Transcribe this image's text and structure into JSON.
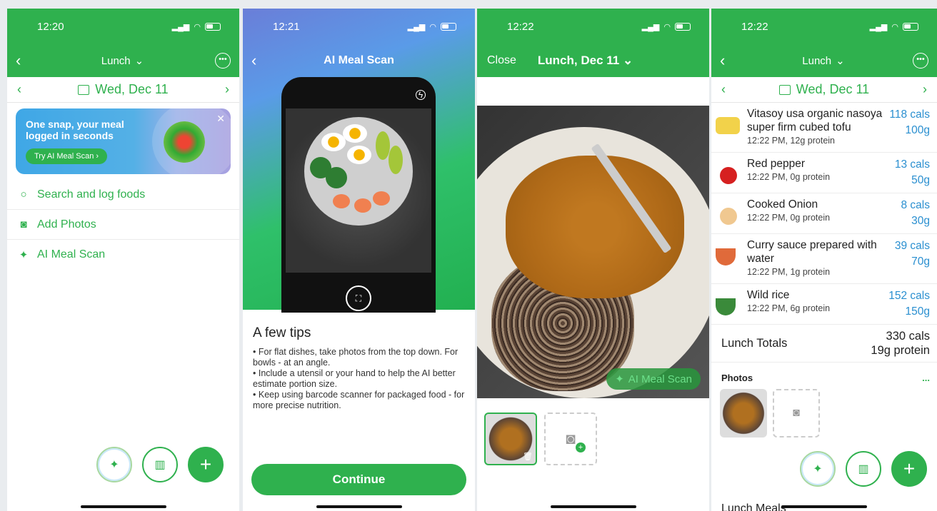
{
  "s1": {
    "time": "12:20",
    "title": "Lunch",
    "date": "Wed, Dec 11",
    "banner": {
      "text": "One snap, your meal logged in seconds",
      "button": "Try AI Meal Scan"
    },
    "menu": [
      {
        "label": "Search and log foods",
        "icon": "search-icon"
      },
      {
        "label": "Add Photos",
        "icon": "camera-icon"
      },
      {
        "label": "AI Meal Scan",
        "icon": "ai-scan-icon"
      }
    ]
  },
  "s2": {
    "time": "12:21",
    "title": "AI Meal Scan",
    "tips_title": "A few tips",
    "tips": [
      "For flat dishes, take photos from the top down. For bowls - at an angle.",
      "Include a utensil or your hand to help the AI better estimate portion size.",
      "Keep using barcode scanner for packaged food - for more precise nutrition."
    ],
    "continue": "Continue"
  },
  "s3": {
    "time": "12:22",
    "close": "Close",
    "title": "Lunch, Dec 11",
    "ai_pill": "AI Meal Scan"
  },
  "s4": {
    "time": "12:22",
    "title": "Lunch",
    "date": "Wed, Dec 11",
    "foods": [
      {
        "name": "Vitasoy usa organic nasoya super firm cubed tofu",
        "meta": "12:22 PM, 12g protein",
        "cals": "118 cals",
        "qty": "100g",
        "color": "#f2d24a"
      },
      {
        "name": "Red pepper",
        "meta": "12:22 PM, 0g protein",
        "cals": "13 cals",
        "qty": "50g",
        "color": "#d62020"
      },
      {
        "name": "Cooked Onion",
        "meta": "12:22 PM, 0g protein",
        "cals": "8 cals",
        "qty": "30g",
        "color": "#f0c890"
      },
      {
        "name": "Curry sauce prepared with water",
        "meta": "12:22 PM, 1g protein",
        "cals": "39 cals",
        "qty": "70g",
        "color": "#e06a3a"
      },
      {
        "name": "Wild rice",
        "meta": "12:22 PM, 6g protein",
        "cals": "152 cals",
        "qty": "150g",
        "color": "#3a8a3a"
      }
    ],
    "totals_label": "Lunch Totals",
    "totals_cals": "330 cals",
    "totals_protein": "19g protein",
    "photos_label": "Photos",
    "photos_more": "...",
    "bottom_label": "Lunch Meals"
  },
  "colors": {
    "brand_green": "#2fb14e",
    "link_blue": "#2a8fd0"
  }
}
